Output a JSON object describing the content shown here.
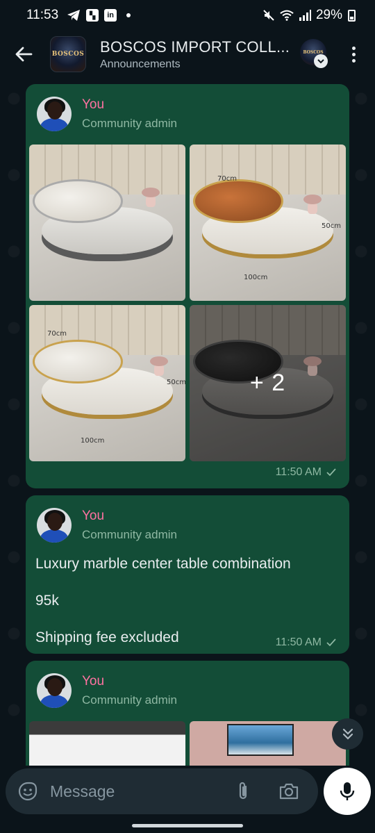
{
  "status_bar": {
    "time": "11:53",
    "battery": "29%",
    "icons": [
      "telegram-icon",
      "capcut-icon",
      "linkedin-icon",
      "mute-icon",
      "wifi-icon",
      "signal-icon",
      "battery-icon"
    ]
  },
  "header": {
    "title": "BOSCOS IMPORT COLL...",
    "subtitle": "Announcements",
    "avatar_text": "BOSCOS"
  },
  "messages": [
    {
      "sender": "You",
      "role": "Community admin",
      "type": "album",
      "more_count": "+ 2",
      "dims": [
        "70cm",
        "50cm",
        "100cm"
      ],
      "time": "11:50 AM"
    },
    {
      "sender": "You",
      "role": "Community admin",
      "type": "text",
      "lines": [
        "Luxury marble center table combination",
        "95k",
        "Shipping fee excluded"
      ],
      "time": "11:50 AM"
    },
    {
      "sender": "You",
      "role": "Community admin",
      "type": "album"
    }
  ],
  "composer": {
    "placeholder": "Message"
  },
  "colors": {
    "background": "#0b141a",
    "bubble": "#134d37",
    "sender_name": "#ff72a1",
    "meta": "#8fb8a3",
    "input_bar": "#1f2c34"
  }
}
